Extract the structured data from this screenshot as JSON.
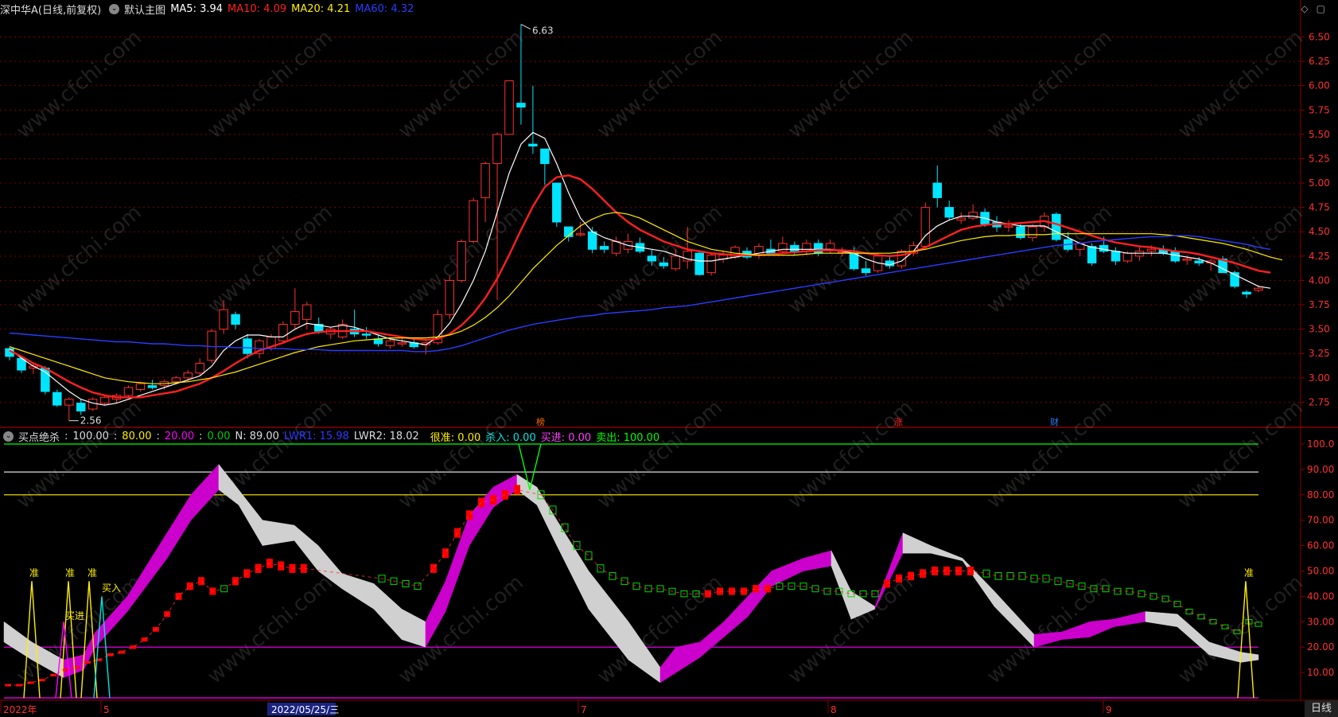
{
  "main_header": {
    "title": "深中华A(日线,前复权)",
    "chart_name": "默认主图",
    "indicators": [
      {
        "label": "MA5: 3.94",
        "color": "#ffffff"
      },
      {
        "label": "MA10: 4.09",
        "color": "#ff2020"
      },
      {
        "label": "MA20: 4.21",
        "color": "#ffee00"
      },
      {
        "label": "MA60: 4.32",
        "color": "#2a3cff"
      }
    ]
  },
  "sub_header": {
    "name": "买点绝杀",
    "values": [
      {
        "label": "100.00",
        "color": "#dddddd"
      },
      {
        "label": "80.00",
        "color": "#ffee00"
      },
      {
        "label": "20.00",
        "color": "#ff00ff"
      },
      {
        "label": "0.00",
        "color": "#00cc00"
      },
      {
        "label": "N: 89.00",
        "color": "#dddddd"
      },
      {
        "label": "LWR1: 15.98",
        "color": "#2a3cff"
      },
      {
        "label": "LWR2: 18.02",
        "color": "#dddddd"
      },
      {
        "label": "很准: 0.00",
        "color": "#ffee00"
      },
      {
        "label": "杀入: 0.00",
        "color": "#00e5e5"
      },
      {
        "label": "买进: 0.00",
        "color": "#ff40ff"
      },
      {
        "label": "卖出: 100.00",
        "color": "#00ff00"
      }
    ]
  },
  "window_icons": [
    "diamond-icon",
    "square-icon"
  ],
  "price_axis": [
    "6.50",
    "6.25",
    "6.00",
    "5.75",
    "5.50",
    "5.25",
    "5.00",
    "4.75",
    "4.50",
    "4.25",
    "4.00",
    "3.75",
    "3.50",
    "3.25",
    "3.00",
    "2.75"
  ],
  "osc_axis": [
    "100.0",
    "90.00",
    "80.00",
    "70.00",
    "60.00",
    "50.00",
    "40.00",
    "30.00",
    "20.00",
    "10.00"
  ],
  "date_axis": [
    "2022年",
    "5",
    "2022/05/25/三",
    "7",
    "8",
    "9"
  ],
  "period_label": "日线",
  "annotations": {
    "high": "6.63",
    "low": "2.56",
    "markers": [
      "榜",
      "涨",
      "财"
    ],
    "signals": [
      "准",
      "准",
      "准",
      "买进",
      "买入",
      "准"
    ]
  },
  "colors": {
    "up": "#ff3030",
    "down": "#00e5ff",
    "grid": "#7a0000",
    "axis_text": "#ff3030"
  },
  "chart_data": {
    "type": "line",
    "title": "深中华A(日线,前复权)",
    "ylim": [
      2.5,
      6.7
    ],
    "candles_ohlc": [
      [
        3.3,
        3.32,
        3.18,
        3.22
      ],
      [
        3.2,
        3.22,
        3.05,
        3.08
      ],
      [
        3.1,
        3.15,
        3.04,
        3.12
      ],
      [
        3.1,
        3.12,
        2.83,
        2.86
      ],
      [
        2.85,
        2.88,
        2.7,
        2.72
      ],
      [
        2.72,
        2.8,
        2.56,
        2.78
      ],
      [
        2.74,
        2.78,
        2.62,
        2.66
      ],
      [
        2.68,
        2.8,
        2.66,
        2.78
      ],
      [
        2.74,
        2.82,
        2.72,
        2.8
      ],
      [
        2.78,
        2.84,
        2.74,
        2.82
      ],
      [
        2.82,
        2.92,
        2.8,
        2.9
      ],
      [
        2.88,
        2.96,
        2.86,
        2.94
      ],
      [
        2.92,
        2.98,
        2.88,
        2.9
      ],
      [
        2.92,
        2.98,
        2.88,
        2.96
      ],
      [
        2.96,
        3.02,
        2.94,
        3.0
      ],
      [
        3.0,
        3.08,
        2.96,
        3.05
      ],
      [
        3.05,
        3.2,
        3.02,
        3.15
      ],
      [
        3.18,
        3.5,
        3.15,
        3.48
      ],
      [
        3.5,
        3.8,
        3.45,
        3.7
      ],
      [
        3.65,
        3.68,
        3.5,
        3.55
      ],
      [
        3.4,
        3.45,
        3.2,
        3.25
      ],
      [
        3.25,
        3.4,
        3.2,
        3.38
      ],
      [
        3.3,
        3.45,
        3.28,
        3.42
      ],
      [
        3.38,
        3.58,
        3.35,
        3.55
      ],
      [
        3.55,
        3.92,
        3.5,
        3.68
      ],
      [
        3.6,
        3.78,
        3.5,
        3.75
      ],
      [
        3.55,
        3.62,
        3.45,
        3.48
      ],
      [
        3.45,
        3.52,
        3.4,
        3.5
      ],
      [
        3.42,
        3.6,
        3.4,
        3.55
      ],
      [
        3.5,
        3.7,
        3.42,
        3.45
      ],
      [
        3.45,
        3.52,
        3.4,
        3.44
      ],
      [
        3.4,
        3.44,
        3.32,
        3.35
      ],
      [
        3.33,
        3.4,
        3.3,
        3.38
      ],
      [
        3.35,
        3.42,
        3.32,
        3.36
      ],
      [
        3.36,
        3.4,
        3.3,
        3.32
      ],
      [
        3.34,
        3.38,
        3.24,
        3.36
      ],
      [
        3.36,
        3.7,
        3.34,
        3.65
      ],
      [
        3.65,
        4.05,
        3.6,
        4.0
      ],
      [
        4.0,
        4.42,
        3.98,
        4.4
      ],
      [
        4.4,
        4.85,
        4.38,
        4.82
      ],
      [
        4.85,
        5.22,
        4.6,
        5.2
      ],
      [
        5.2,
        5.52,
        3.8,
        5.5
      ],
      [
        5.5,
        6.05,
        5.5,
        6.05
      ],
      [
        5.82,
        6.63,
        5.6,
        5.78
      ],
      [
        5.4,
        6.0,
        5.3,
        5.38
      ],
      [
        5.35,
        5.35,
        4.98,
        5.2
      ],
      [
        5.0,
        5.0,
        4.55,
        4.6
      ],
      [
        4.55,
        4.55,
        4.4,
        4.45
      ],
      [
        4.48,
        4.6,
        4.45,
        4.48
      ],
      [
        4.5,
        4.55,
        4.28,
        4.32
      ],
      [
        4.35,
        4.4,
        4.28,
        4.32
      ],
      [
        4.28,
        4.45,
        4.25,
        4.4
      ],
      [
        4.32,
        4.48,
        4.28,
        4.4
      ],
      [
        4.38,
        4.44,
        4.28,
        4.3
      ],
      [
        4.25,
        4.32,
        4.15,
        4.2
      ],
      [
        4.18,
        4.24,
        4.12,
        4.15
      ],
      [
        4.12,
        4.32,
        4.1,
        4.25
      ],
      [
        4.2,
        4.55,
        4.12,
        4.3
      ],
      [
        4.28,
        4.3,
        4.05,
        4.06
      ],
      [
        4.08,
        4.28,
        4.05,
        4.26
      ],
      [
        4.22,
        4.3,
        4.18,
        4.26
      ],
      [
        4.24,
        4.36,
        4.22,
        4.34
      ],
      [
        4.3,
        4.34,
        4.22,
        4.24
      ],
      [
        4.26,
        4.38,
        4.22,
        4.35
      ],
      [
        4.32,
        4.42,
        4.26,
        4.28
      ],
      [
        4.3,
        4.45,
        4.28,
        4.38
      ],
      [
        4.36,
        4.4,
        4.26,
        4.3
      ],
      [
        4.3,
        4.42,
        4.26,
        4.38
      ],
      [
        4.38,
        4.42,
        4.25,
        4.28
      ],
      [
        4.32,
        4.42,
        4.28,
        4.38
      ],
      [
        4.3,
        4.34,
        4.25,
        4.3
      ],
      [
        4.28,
        4.34,
        4.1,
        4.12
      ],
      [
        4.12,
        4.2,
        4.05,
        4.08
      ],
      [
        4.1,
        4.28,
        4.08,
        4.25
      ],
      [
        4.2,
        4.26,
        4.12,
        4.15
      ],
      [
        4.15,
        4.32,
        4.12,
        4.3
      ],
      [
        4.28,
        4.4,
        4.25,
        4.36
      ],
      [
        4.35,
        4.8,
        4.32,
        4.75
      ],
      [
        5.0,
        5.18,
        4.75,
        4.85
      ],
      [
        4.75,
        4.82,
        4.62,
        4.65
      ],
      [
        4.62,
        4.7,
        4.58,
        4.64
      ],
      [
        4.64,
        4.78,
        4.62,
        4.7
      ],
      [
        4.7,
        4.74,
        4.55,
        4.58
      ],
      [
        4.6,
        4.66,
        4.5,
        4.55
      ],
      [
        4.55,
        4.62,
        4.5,
        4.56
      ],
      [
        4.55,
        4.58,
        4.42,
        4.44
      ],
      [
        4.44,
        4.58,
        4.4,
        4.55
      ],
      [
        4.55,
        4.7,
        4.5,
        4.66
      ],
      [
        4.68,
        4.7,
        4.4,
        4.42
      ],
      [
        4.42,
        4.5,
        4.3,
        4.32
      ],
      [
        4.32,
        4.4,
        4.25,
        4.38
      ],
      [
        4.35,
        4.38,
        4.15,
        4.18
      ],
      [
        4.36,
        4.45,
        4.28,
        4.3
      ],
      [
        4.3,
        4.34,
        4.16,
        4.2
      ],
      [
        4.2,
        4.3,
        4.18,
        4.28
      ],
      [
        4.25,
        4.34,
        4.2,
        4.3
      ],
      [
        4.3,
        4.36,
        4.25,
        4.32
      ],
      [
        4.32,
        4.36,
        4.26,
        4.28
      ],
      [
        4.3,
        4.34,
        4.18,
        4.2
      ],
      [
        4.22,
        4.26,
        4.16,
        4.22
      ],
      [
        4.2,
        4.24,
        4.15,
        4.18
      ],
      [
        4.18,
        4.22,
        4.1,
        4.2
      ],
      [
        4.22,
        4.25,
        4.08,
        4.08
      ],
      [
        4.08,
        4.1,
        3.92,
        3.94
      ],
      [
        3.88,
        3.9,
        3.82,
        3.86
      ],
      [
        3.9,
        3.95,
        3.88,
        3.92
      ]
    ],
    "series": [
      {
        "name": "MA5",
        "values": [
          3.3,
          3.2,
          3.12,
          3.06,
          2.96,
          2.86,
          2.78,
          2.74,
          2.72,
          2.74,
          2.78,
          2.82,
          2.86,
          2.9,
          2.94,
          2.98,
          3.02,
          3.12,
          3.28,
          3.38,
          3.44,
          3.44,
          3.42,
          3.42,
          3.5,
          3.56,
          3.54,
          3.52,
          3.54,
          3.52,
          3.48,
          3.44,
          3.4,
          3.38,
          3.36,
          3.34,
          3.42,
          3.56,
          3.76,
          4.0,
          4.3,
          4.7,
          5.1,
          5.4,
          5.52,
          5.46,
          5.2,
          4.9,
          4.64,
          4.5,
          4.44,
          4.4,
          4.36,
          4.34,
          4.32,
          4.3,
          4.26,
          4.22,
          4.2,
          4.2,
          4.22,
          4.24,
          4.26,
          4.28,
          4.3,
          4.32,
          4.32,
          4.32,
          4.32,
          4.32,
          4.3,
          4.28,
          4.22,
          4.18,
          4.16,
          4.2,
          4.3,
          4.46,
          4.56,
          4.62,
          4.66,
          4.66,
          4.64,
          4.6,
          4.58,
          4.56,
          4.56,
          4.56,
          4.5,
          4.44,
          4.38,
          4.34,
          4.32,
          4.3,
          4.28,
          4.28,
          4.28,
          4.28,
          4.26,
          4.24,
          4.22,
          4.18,
          4.12,
          4.06,
          4.0,
          3.94,
          3.92
        ]
      },
      {
        "name": "MA10",
        "values": [
          3.28,
          3.22,
          3.15,
          3.1,
          3.03,
          2.96,
          2.9,
          2.85,
          2.82,
          2.8,
          2.8,
          2.8,
          2.82,
          2.84,
          2.86,
          2.9,
          2.94,
          3.0,
          3.07,
          3.15,
          3.22,
          3.28,
          3.32,
          3.36,
          3.41,
          3.45,
          3.47,
          3.48,
          3.48,
          3.48,
          3.48,
          3.46,
          3.44,
          3.42,
          3.4,
          3.39,
          3.4,
          3.45,
          3.54,
          3.66,
          3.82,
          4.02,
          4.26,
          4.52,
          4.76,
          4.96,
          5.06,
          5.08,
          5.04,
          4.94,
          4.82,
          4.7,
          4.6,
          4.52,
          4.46,
          4.4,
          4.36,
          4.32,
          4.3,
          4.28,
          4.27,
          4.26,
          4.26,
          4.26,
          4.27,
          4.28,
          4.29,
          4.3,
          4.31,
          4.31,
          4.31,
          4.3,
          4.28,
          4.26,
          4.25,
          4.26,
          4.29,
          4.34,
          4.4,
          4.46,
          4.52,
          4.55,
          4.57,
          4.58,
          4.58,
          4.59,
          4.6,
          4.61,
          4.58,
          4.54,
          4.5,
          4.46,
          4.42,
          4.39,
          4.37,
          4.35,
          4.34,
          4.32,
          4.3,
          4.29,
          4.27,
          4.24,
          4.21,
          4.18,
          4.14,
          4.1,
          4.08
        ]
      },
      {
        "name": "MA20",
        "values": [
          3.32,
          3.28,
          3.24,
          3.2,
          3.16,
          3.12,
          3.08,
          3.04,
          3.0,
          2.98,
          2.96,
          2.95,
          2.94,
          2.94,
          2.95,
          2.96,
          2.98,
          3.0,
          3.03,
          3.06,
          3.1,
          3.14,
          3.18,
          3.22,
          3.26,
          3.29,
          3.32,
          3.34,
          3.36,
          3.38,
          3.39,
          3.4,
          3.41,
          3.41,
          3.41,
          3.41,
          3.42,
          3.44,
          3.48,
          3.54,
          3.62,
          3.72,
          3.84,
          3.98,
          4.12,
          4.24,
          4.36,
          4.46,
          4.56,
          4.63,
          4.68,
          4.7,
          4.68,
          4.64,
          4.58,
          4.52,
          4.46,
          4.4,
          4.36,
          4.32,
          4.3,
          4.28,
          4.27,
          4.26,
          4.26,
          4.26,
          4.26,
          4.27,
          4.28,
          4.28,
          4.28,
          4.28,
          4.28,
          4.28,
          4.28,
          4.29,
          4.3,
          4.32,
          4.35,
          4.38,
          4.41,
          4.43,
          4.45,
          4.46,
          4.46,
          4.47,
          4.47,
          4.47,
          4.48,
          4.48,
          4.48,
          4.48,
          4.48,
          4.48,
          4.48,
          4.48,
          4.48,
          4.47,
          4.46,
          4.44,
          4.42,
          4.4,
          4.38,
          4.35,
          4.32,
          4.28,
          4.24,
          4.21
        ]
      },
      {
        "name": "MA60",
        "values": [
          3.46,
          3.45,
          3.44,
          3.43,
          3.42,
          3.41,
          3.4,
          3.39,
          3.38,
          3.37,
          3.37,
          3.36,
          3.35,
          3.35,
          3.34,
          3.33,
          3.33,
          3.32,
          3.32,
          3.31,
          3.31,
          3.3,
          3.3,
          3.3,
          3.29,
          3.29,
          3.29,
          3.28,
          3.28,
          3.28,
          3.28,
          3.28,
          3.28,
          3.28,
          3.27,
          3.27,
          3.28,
          3.3,
          3.33,
          3.37,
          3.41,
          3.45,
          3.49,
          3.52,
          3.55,
          3.57,
          3.59,
          3.61,
          3.63,
          3.64,
          3.66,
          3.67,
          3.68,
          3.69,
          3.7,
          3.72,
          3.73,
          3.74,
          3.76,
          3.78,
          3.8,
          3.82,
          3.84,
          3.86,
          3.88,
          3.9,
          3.92,
          3.94,
          3.96,
          3.98,
          4.0,
          4.02,
          4.04,
          4.06,
          4.08,
          4.1,
          4.12,
          4.14,
          4.16,
          4.18,
          4.2,
          4.22,
          4.24,
          4.26,
          4.28,
          4.3,
          4.32,
          4.34,
          4.36,
          4.37,
          4.38,
          4.4,
          4.41,
          4.42,
          4.43,
          4.44,
          4.45,
          4.45,
          4.46,
          4.46,
          4.45,
          4.43,
          4.41,
          4.39,
          4.37,
          4.34,
          4.32
        ]
      }
    ]
  }
}
